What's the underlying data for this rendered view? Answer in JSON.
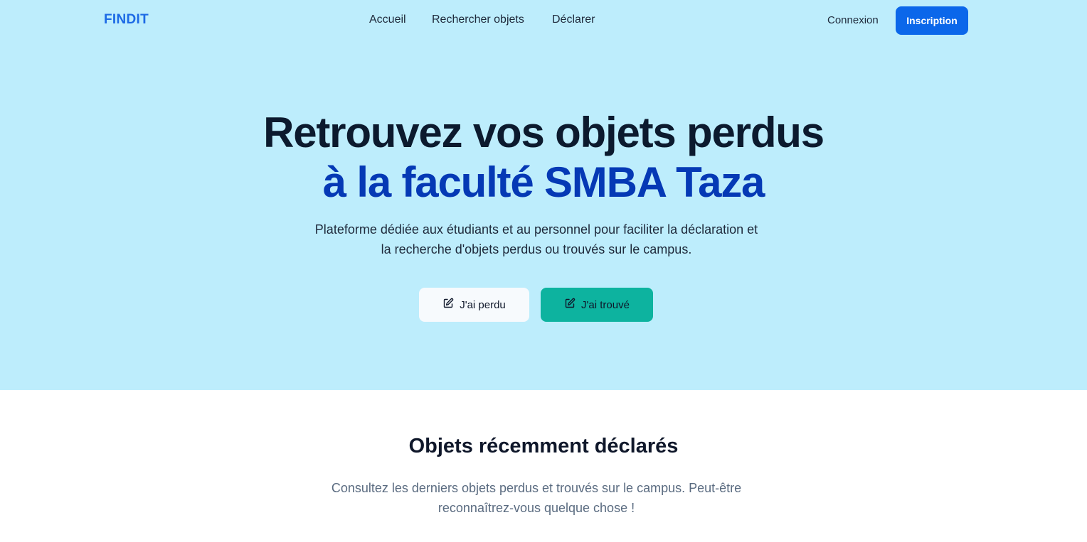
{
  "nav": {
    "logo": "FINDIT",
    "links": [
      "Accueil",
      "Rechercher objets",
      "Déclarer"
    ],
    "login": "Connexion",
    "signup": "Inscription"
  },
  "hero": {
    "title_line1": "Retrouvez vos objets perdus",
    "title_line2": "à la faculté SMBA Taza",
    "subtitle_line1": "Plateforme dédiée aux étudiants et au personnel pour faciliter la déclaration et",
    "subtitle_line2": "la recherche d'objets perdus ou trouvés sur le campus.",
    "btn_lost": {
      "label": "J'ai perdu",
      "icon": "edit-icon"
    },
    "btn_found": {
      "label": "J'ai trouvé",
      "icon": "edit-icon"
    }
  },
  "recent": {
    "title": "Objets récemment déclarés",
    "subtitle_line1": "Consultez les derniers objets perdus et trouvés sur le campus. Peut-être",
    "subtitle_line2": "reconnaîtrez-vous quelque chose !"
  },
  "colors": {
    "hero_bg": "#bdedfc",
    "primary": "#0b67ea",
    "title_accent": "#0539b5",
    "teal": "#0db39f"
  }
}
